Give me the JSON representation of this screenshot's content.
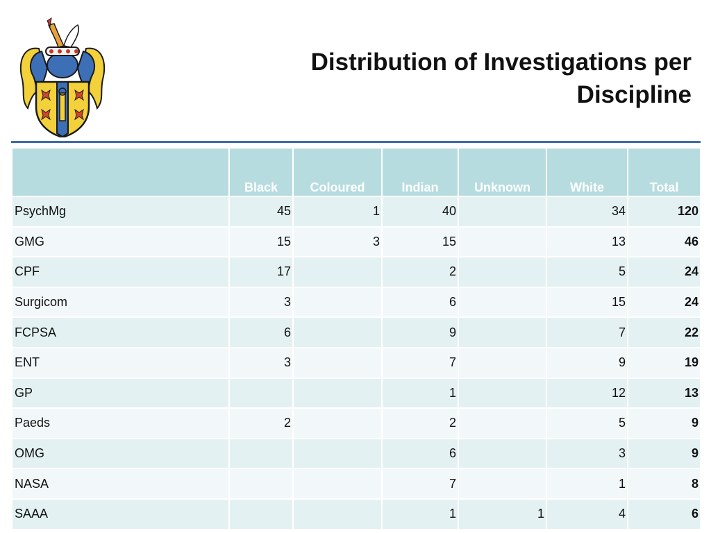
{
  "slide": {
    "title_line1": "Distribution of Investigations per",
    "title_line2": "Discipline"
  },
  "crest_icon": "coat-of-arms-crest",
  "colors": {
    "accent_rule": "#3b6ea5",
    "header_fill": "#b7dcdf",
    "row_fill_odd": "#e4f1f2",
    "row_fill_even": "#f2f8f9"
  },
  "table": {
    "columns": [
      "",
      "Black",
      "Coloured",
      "Indian",
      "Unknown",
      "White",
      "Total"
    ],
    "rows": [
      [
        "PsychMg",
        "45",
        "1",
        "40",
        "",
        "34",
        "120"
      ],
      [
        "GMG",
        "15",
        "3",
        "15",
        "",
        "13",
        "46"
      ],
      [
        "CPF",
        "17",
        "",
        "2",
        "",
        "5",
        "24"
      ],
      [
        "Surgicom",
        "3",
        "",
        "6",
        "",
        "15",
        "24"
      ],
      [
        "FCPSA",
        "6",
        "",
        "9",
        "",
        "7",
        "22"
      ],
      [
        "ENT",
        "3",
        "",
        "7",
        "",
        "9",
        "19"
      ],
      [
        "GP",
        "",
        "",
        "1",
        "",
        "12",
        "13"
      ],
      [
        "Paeds",
        "2",
        "",
        "2",
        "",
        "5",
        "9"
      ],
      [
        "OMG",
        "",
        "",
        "6",
        "",
        "3",
        "9"
      ],
      [
        "NASA",
        "",
        "",
        "7",
        "",
        "1",
        "8"
      ],
      [
        "SAAA",
        "",
        "",
        "1",
        "1",
        "4",
        "6"
      ]
    ]
  }
}
